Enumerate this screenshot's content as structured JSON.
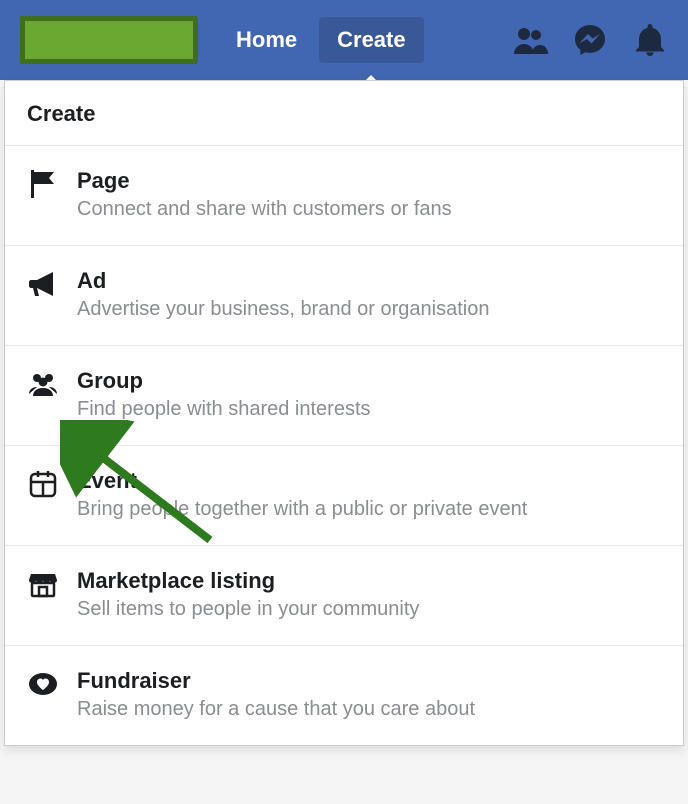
{
  "nav": {
    "home_label": "Home",
    "create_label": "Create"
  },
  "top_icons": {
    "friends": "friend-requests-icon",
    "messages": "messenger-icon",
    "notifications": "notifications-icon"
  },
  "dropdown": {
    "header": "Create",
    "items": [
      {
        "icon": "flag-icon",
        "title": "Page",
        "desc": "Connect and share with customers or fans"
      },
      {
        "icon": "megaphone-icon",
        "title": "Ad",
        "desc": "Advertise your business, brand or organisation"
      },
      {
        "icon": "group-icon",
        "title": "Group",
        "desc": "Find people with shared interests"
      },
      {
        "icon": "calendar-icon",
        "title": "Event",
        "desc": "Bring people together with a public or private event"
      },
      {
        "icon": "storefront-icon",
        "title": "Marketplace listing",
        "desc": "Sell items to people in your community"
      },
      {
        "icon": "heart-coin-icon",
        "title": "Fundraiser",
        "desc": "Raise money for a cause that you care about"
      }
    ]
  },
  "annotation": {
    "target": "Group"
  }
}
